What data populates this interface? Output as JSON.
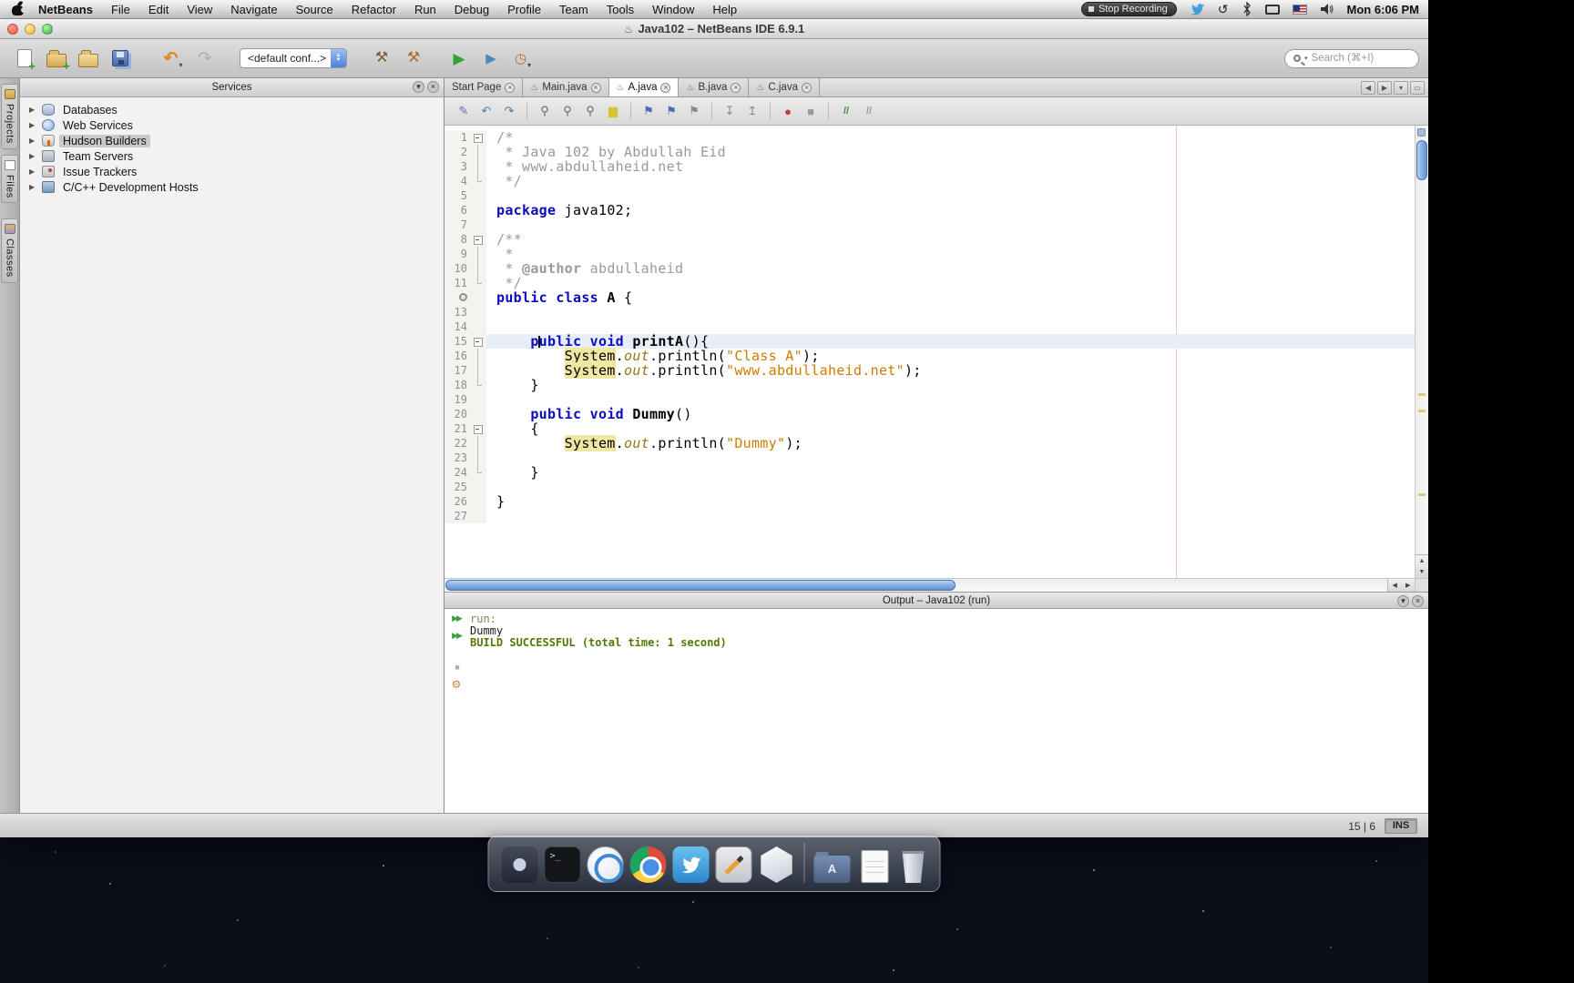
{
  "menubar": {
    "app_name": "NetBeans",
    "items": [
      "File",
      "Edit",
      "View",
      "Navigate",
      "Source",
      "Refactor",
      "Run",
      "Debug",
      "Profile",
      "Team",
      "Tools",
      "Window",
      "Help"
    ],
    "status": {
      "stop_recording_label": "Stop Recording",
      "clock": "Mon 6:06 PM",
      "icons": [
        "twitter-icon",
        "time-machine-icon",
        "bluetooth-icon",
        "display-icon",
        "us-flag-icon",
        "volume-icon"
      ]
    }
  },
  "window": {
    "title": "Java102 – NetBeans IDE 6.9.1",
    "traffic_lights": [
      "close",
      "minimize",
      "zoom"
    ]
  },
  "toolbar": {
    "icons": [
      "new-file-icon",
      "new-project-icon",
      "open-project-icon",
      "save-all-icon",
      "undo-icon",
      "redo-icon",
      "build-icon",
      "clean-build-icon",
      "run-icon",
      "debug-icon",
      "profile-icon"
    ],
    "config_value": "<default conf...>",
    "search_placeholder": "Search (⌘+I)"
  },
  "left_rail": {
    "tabs": [
      "Projects",
      "Files",
      "Classes"
    ]
  },
  "services": {
    "title": "Services",
    "items": [
      {
        "label": "Databases",
        "icon": "database-icon",
        "selected": false
      },
      {
        "label": "Web Services",
        "icon": "web-services-icon",
        "selected": false
      },
      {
        "label": "Hudson Builders",
        "icon": "hudson-icon",
        "selected": true
      },
      {
        "label": "Team Servers",
        "icon": "team-servers-icon",
        "selected": false
      },
      {
        "label": "Issue Trackers",
        "icon": "issue-tracker-icon",
        "selected": false
      },
      {
        "label": "C/C++ Development Hosts",
        "icon": "cpp-host-icon",
        "selected": false
      }
    ]
  },
  "editor": {
    "tabs": [
      {
        "label": "Start Page",
        "icon": null,
        "active": false
      },
      {
        "label": "Main.java",
        "icon": "java-file-icon",
        "active": false
      },
      {
        "label": "A.java",
        "icon": "java-file-icon",
        "active": true
      },
      {
        "label": "B.java",
        "icon": "java-file-icon",
        "active": false
      },
      {
        "label": "C.java",
        "icon": "java-file-icon",
        "active": false
      }
    ],
    "toolbar_icons": [
      "last-edit-icon",
      "back-icon",
      "forward-icon",
      "find-selection-icon",
      "find-next-icon",
      "find-previous-icon",
      "toggle-highlight-icon",
      "previous-bookmark-icon",
      "next-bookmark-icon",
      "toggle-bookmark-icon",
      "next-error-icon",
      "previous-error-icon",
      "start-macro-icon",
      "stop-macro-icon",
      "comment-icon",
      "uncomment-icon"
    ],
    "caret": {
      "line": 15,
      "column": 6
    },
    "lines": [
      {
        "n": 1,
        "f": "s",
        "segs": [
          [
            "cm",
            "/*"
          ]
        ]
      },
      {
        "n": 2,
        "f": "m",
        "segs": [
          [
            "cm",
            " * Java 102 by Abdullah Eid"
          ]
        ]
      },
      {
        "n": 3,
        "f": "m",
        "segs": [
          [
            "cm",
            " * www.abdullaheid.net"
          ]
        ]
      },
      {
        "n": 4,
        "f": "e",
        "segs": [
          [
            "cm",
            " */"
          ]
        ]
      },
      {
        "n": 5,
        "segs": []
      },
      {
        "n": 6,
        "segs": [
          [
            "kw",
            "package"
          ],
          [
            "pl",
            " java102;"
          ]
        ]
      },
      {
        "n": 7,
        "segs": []
      },
      {
        "n": 8,
        "f": "s",
        "segs": [
          [
            "cm",
            "/**"
          ]
        ]
      },
      {
        "n": 9,
        "f": "m",
        "segs": [
          [
            "cm",
            " *"
          ]
        ]
      },
      {
        "n": 10,
        "f": "m",
        "segs": [
          [
            "cm",
            " * "
          ],
          [
            "jd",
            "@author"
          ],
          [
            "cm",
            " abdullaheid"
          ]
        ]
      },
      {
        "n": 11,
        "f": "e",
        "segs": [
          [
            "cm",
            " */"
          ]
        ]
      },
      {
        "n": 12,
        "ic": true,
        "segs": [
          [
            "kw",
            "public"
          ],
          [
            "pl",
            " "
          ],
          [
            "kw",
            "class"
          ],
          [
            "pl",
            " "
          ],
          [
            "typ",
            "A"
          ],
          [
            "pl",
            " {"
          ]
        ]
      },
      {
        "n": 13,
        "segs": []
      },
      {
        "n": 14,
        "segs": []
      },
      {
        "n": 15,
        "f": "s",
        "cur": true,
        "segs": [
          [
            "pl",
            "    "
          ],
          [
            "kw",
            "p"
          ],
          [
            "caret",
            ""
          ],
          [
            "kw",
            "ublic"
          ],
          [
            "pl",
            " "
          ],
          [
            "kw",
            "void"
          ],
          [
            "pl",
            " "
          ],
          [
            "mth",
            "printA"
          ],
          [
            "pl",
            "(){"
          ]
        ]
      },
      {
        "n": 16,
        "f": "m",
        "segs": [
          [
            "pl",
            "        "
          ],
          [
            "occ",
            "System"
          ],
          [
            "pl",
            "."
          ],
          [
            "fld",
            "out"
          ],
          [
            "pl",
            ".println("
          ],
          [
            "str",
            "\"Class A\""
          ],
          [
            "pl",
            ");"
          ]
        ]
      },
      {
        "n": 17,
        "f": "m",
        "segs": [
          [
            "pl",
            "        "
          ],
          [
            "occ",
            "System"
          ],
          [
            "pl",
            "."
          ],
          [
            "fld",
            "out"
          ],
          [
            "pl",
            ".println("
          ],
          [
            "str",
            "\"www.abdullaheid.net\""
          ],
          [
            "pl",
            ");"
          ]
        ]
      },
      {
        "n": 18,
        "f": "e",
        "segs": [
          [
            "pl",
            "    }"
          ]
        ]
      },
      {
        "n": 19,
        "segs": []
      },
      {
        "n": 20,
        "segs": [
          [
            "pl",
            "    "
          ],
          [
            "kw",
            "public"
          ],
          [
            "pl",
            " "
          ],
          [
            "kw",
            "void"
          ],
          [
            "pl",
            " "
          ],
          [
            "mth",
            "Dummy"
          ],
          [
            "pl",
            "()"
          ]
        ]
      },
      {
        "n": 21,
        "f": "s",
        "segs": [
          [
            "pl",
            "    {"
          ]
        ]
      },
      {
        "n": 22,
        "f": "m",
        "segs": [
          [
            "pl",
            "        "
          ],
          [
            "occ",
            "System"
          ],
          [
            "pl",
            "."
          ],
          [
            "fld",
            "out"
          ],
          [
            "pl",
            ".println("
          ],
          [
            "str",
            "\"Dummy\""
          ],
          [
            "pl",
            ");"
          ]
        ]
      },
      {
        "n": 23,
        "f": "m",
        "segs": []
      },
      {
        "n": 24,
        "f": "e",
        "segs": [
          [
            "pl",
            "    }"
          ]
        ]
      },
      {
        "n": 25,
        "segs": []
      },
      {
        "n": 26,
        "segs": [
          [
            "pl",
            "}"
          ]
        ]
      },
      {
        "n": 27,
        "segs": []
      }
    ]
  },
  "output": {
    "title": "Output – Java102 (run)",
    "action_icons": [
      "rerun-icon",
      "rerun-debug-icon",
      "stop-build-icon",
      "ant-settings-icon"
    ],
    "lines": [
      {
        "text": "run:",
        "style": "note"
      },
      {
        "text": "Dummy",
        "style": "plain"
      },
      {
        "text": "BUILD SUCCESSFUL (total time: 1 second)",
        "style": "success"
      }
    ]
  },
  "statusbar": {
    "caret_position": "15 | 6",
    "mode": "INS"
  },
  "dock": {
    "icons": [
      "photo-booth-icon",
      "terminal-icon",
      "safari-icon",
      "chrome-icon",
      "twitter-app-icon",
      "annotate-icon",
      "netbeans-cube-icon",
      "applications-folder-icon",
      "documents-icon",
      "trash-icon"
    ]
  },
  "colors": {
    "keyword": "#0b0bc0",
    "comment": "#999999",
    "string": "#ce7b00",
    "static_field": "#8f7a1b",
    "occurrence_bg": "#efe7a3",
    "current_line_bg": "#e8eef7",
    "margin_line": "#f2c4c4",
    "success_text": "#527a00",
    "selection_bg": "#c9c9c9",
    "run_green": "#2fa32f",
    "undo_orange": "#e08818"
  }
}
